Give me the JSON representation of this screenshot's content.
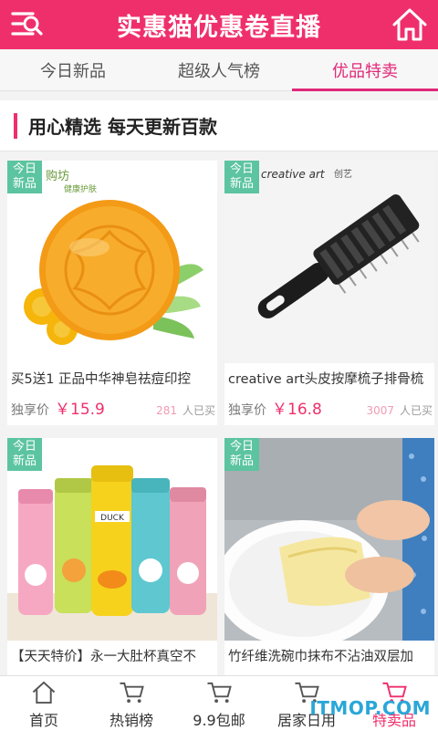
{
  "header": {
    "title": "实惠猫优惠卷直播",
    "menu_icon": "menu-icon",
    "home_icon": "home-icon"
  },
  "tabs": [
    {
      "label": "今日新品",
      "active": false
    },
    {
      "label": "超级人气榜",
      "active": false
    },
    {
      "label": "优品特卖",
      "active": true
    }
  ],
  "section": {
    "title": "用心精选  每天更新百款"
  },
  "products": [
    {
      "badge": "今日\n新品",
      "badge_line1": "今日",
      "badge_line2": "新品",
      "brand_text": "购坊",
      "brand_sub": "健康护肤",
      "name": "买5送1 正品中华神皂祛痘印控",
      "price_label": "独享价",
      "price": "￥15.9",
      "sold_count": "281",
      "sold_suffix": "人已买"
    },
    {
      "badge_line1": "今日",
      "badge_line2": "新品",
      "brand_text": "creative art",
      "brand_sub": "创艺",
      "name": "creative art头皮按摩梳子排骨梳",
      "price_label": "独享价",
      "price": "￥16.8",
      "sold_count": "3007",
      "sold_suffix": "人已买"
    },
    {
      "badge_line1": "今日",
      "badge_line2": "新品",
      "name": "【天天特价】永一大肚杯真空不",
      "cup_label": "DUCK"
    },
    {
      "badge_line1": "今日",
      "badge_line2": "新品",
      "name": "竹纤维洗碗巾抹布不沾油双层加"
    }
  ],
  "bottom_nav": [
    {
      "label": "首页",
      "icon": "home-icon",
      "active": false
    },
    {
      "label": "热销榜",
      "icon": "cart-icon",
      "active": false
    },
    {
      "label": "9.9包邮",
      "icon": "cart-icon",
      "active": false
    },
    {
      "label": "居家日用",
      "icon": "cart-icon",
      "active": false
    },
    {
      "label": "特卖品",
      "icon": "cart-icon",
      "active": true
    }
  ],
  "watermark": "ITMOP.COM",
  "colors": {
    "brand": "#ef2f6c",
    "tab_active": "#e0287a",
    "badge": "#5cc4a0",
    "price": "#ef2f6c"
  }
}
